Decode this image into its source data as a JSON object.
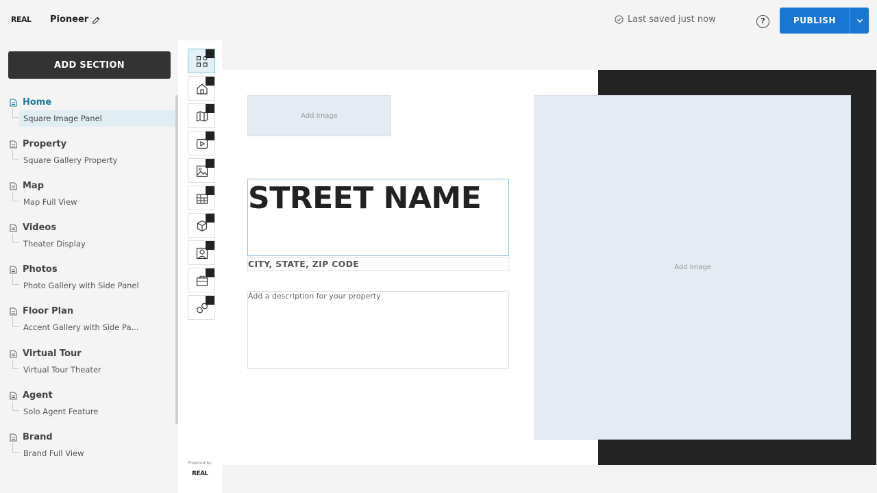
{
  "header": {
    "logo": "REAL",
    "site_name": "Pioneer",
    "save_status": "Last saved just now",
    "help": "?",
    "publish_label": "PUBLISH"
  },
  "sidebar": {
    "add_section_label": "ADD SECTION",
    "items": [
      {
        "title": "Home",
        "sub": "Square Image Panel",
        "active": true
      },
      {
        "title": "Property",
        "sub": "Square Gallery Property"
      },
      {
        "title": "Map",
        "sub": "Map Full View"
      },
      {
        "title": "Videos",
        "sub": "Theater Display"
      },
      {
        "title": "Photos",
        "sub": "Photo Gallery with Side Panel"
      },
      {
        "title": "Floor Plan",
        "sub": "Accent Gallery with Side Pa..."
      },
      {
        "title": "Virtual Tour",
        "sub": "Virtual Tour Theater"
      },
      {
        "title": "Agent",
        "sub": "Solo Agent Feature"
      },
      {
        "title": "Brand",
        "sub": "Brand Full View"
      }
    ]
  },
  "rail": {
    "icons": [
      "layout-grid-icon",
      "home-icon",
      "map-icon",
      "video-icon",
      "photo-icon",
      "floor-plan-icon",
      "virtual-tour-icon",
      "agent-icon",
      "brand-icon",
      "link-icon"
    ],
    "powered_by": "Powered by",
    "logo": "REAL"
  },
  "canvas": {
    "small_image_label": "Add Image",
    "large_image_label": "Add Image",
    "street_name": "STREET NAME",
    "city_line": "CITY, STATE, ZIP CODE",
    "description_placeholder": "Add a description for your property"
  },
  "colors": {
    "accent": "#1976d2",
    "active_nav": "#1f7a9c",
    "dark_panel": "#232323"
  }
}
